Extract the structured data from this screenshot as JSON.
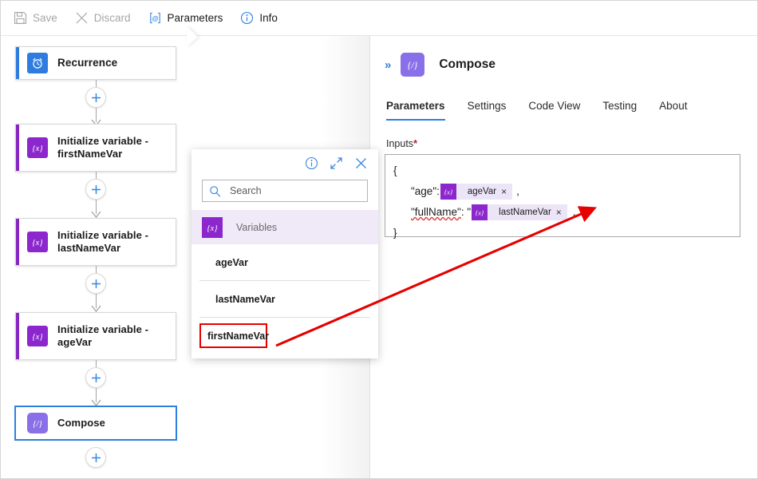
{
  "toolbar": {
    "items": [
      {
        "label": "Save",
        "icon": "save-icon",
        "enabled": false
      },
      {
        "label": "Discard",
        "icon": "discard-icon",
        "enabled": false
      },
      {
        "label": "Parameters",
        "icon": "parameters-icon",
        "enabled": true
      },
      {
        "label": "Info",
        "icon": "info-icon",
        "enabled": true
      }
    ]
  },
  "canvas": {
    "nodes": [
      {
        "title": "Recurrence",
        "icon": "clock-icon",
        "kind": "trigger",
        "selected": false
      },
      {
        "title": "Initialize variable - firstNameVar",
        "icon": "variable-icon",
        "kind": "action",
        "selected": false
      },
      {
        "title": "Initialize variable - lastNameVar",
        "icon": "variable-icon",
        "kind": "action",
        "selected": false
      },
      {
        "title": "Initialize variable - ageVar",
        "icon": "variable-icon",
        "kind": "action",
        "selected": false
      },
      {
        "title": "Compose",
        "icon": "compose-icon",
        "kind": "action",
        "selected": true
      }
    ],
    "add_button_label": "+"
  },
  "popup": {
    "header_icons": [
      "info-icon",
      "expand-icon",
      "close-icon"
    ],
    "search": {
      "value": "",
      "placeholder": "Search"
    },
    "group": {
      "name": "Variables",
      "icon": "variable-icon"
    },
    "items": [
      {
        "label": "ageVar",
        "highlighted": false
      },
      {
        "label": "lastNameVar",
        "highlighted": false
      },
      {
        "label": "firstNameVar",
        "highlighted": true
      }
    ]
  },
  "panel": {
    "collapse_icon": "chevron-double-right-icon",
    "icon": "compose-icon",
    "title": "Compose",
    "tabs": [
      {
        "label": "Parameters",
        "active": true
      },
      {
        "label": "Settings",
        "active": false
      },
      {
        "label": "Code View",
        "active": false
      },
      {
        "label": "Testing",
        "active": false
      },
      {
        "label": "About",
        "active": false
      }
    ],
    "inputs_field": {
      "label": "Inputs",
      "required_marker": "*",
      "lines": {
        "open_brace": "{",
        "age_key": "\"age\":",
        "age_token": {
          "label": "ageVar",
          "remove": "×"
        },
        "age_trailing": ",",
        "fullname_key": "\"fullName\"",
        "fullname_sep": ": \"",
        "fullname_token": {
          "label": "lastNameVar",
          "remove": "×"
        },
        "fullname_trailing": ",",
        "close_brace": "}"
      }
    }
  },
  "annotation": {
    "arrow_color": "#e60000",
    "highlight_color": "#e60000"
  }
}
